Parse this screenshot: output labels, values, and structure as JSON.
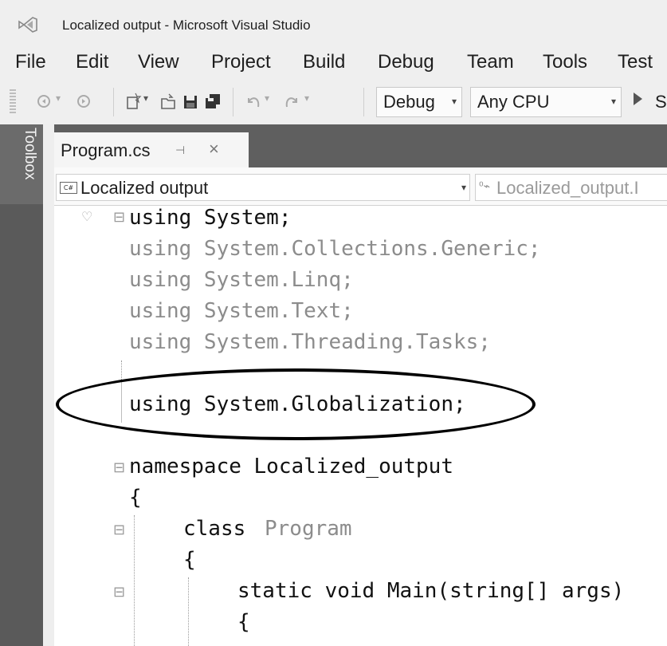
{
  "window": {
    "title": "Localized output - Microsoft Visual Studio",
    "logo_icon": "visual-studio-logo-icon"
  },
  "menu": {
    "items": [
      "File",
      "Edit",
      "View",
      "Project",
      "Build",
      "Debug",
      "Team",
      "Tools",
      "Test"
    ]
  },
  "toolbar": {
    "icons": [
      "back-icon",
      "forward-icon",
      "new-project-icon",
      "open-file-icon",
      "save-icon",
      "save-all-icon",
      "undo-icon",
      "redo-icon"
    ],
    "configuration": "Debug",
    "platform": "Any CPU",
    "start_label": "S"
  },
  "sidebar": {
    "toolbox_label": "Toolbox"
  },
  "document": {
    "tab_label": "Program.cs",
    "project_selector": "Localized output",
    "member_selector": "Localized_output.I"
  },
  "code": {
    "line1": "using System;",
    "line2": "using System.Collections.Generic;",
    "line3": "using System.Linq;",
    "line4": "using System.Text;",
    "line5": "using System.Threading.Tasks;",
    "line7": "using System.Globalization;",
    "line9": "namespace Localized_output",
    "line10": "{",
    "line11_kw": "class",
    "line11_name": "Program",
    "line12": "{",
    "line13": "static void Main(string[] args)",
    "line14": "{"
  },
  "colors": {
    "sidebar": "#5a5a5a",
    "tabrow": "#5f5f5f",
    "editor_bg": "#ffffff",
    "faded_code": "#8c8c8c"
  }
}
